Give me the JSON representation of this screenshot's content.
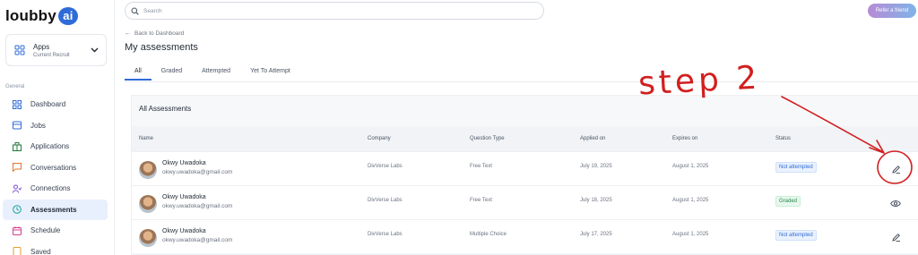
{
  "brand": {
    "logo_text": "loubby",
    "logo_ai": "ai"
  },
  "apps": {
    "title": "Apps",
    "subtitle": "Current Recruit"
  },
  "sidebar": {
    "section_label": "General",
    "items": [
      {
        "label": "Dashboard",
        "icon": "grid-icon"
      },
      {
        "label": "Jobs",
        "icon": "briefcase-icon"
      },
      {
        "label": "Applications",
        "icon": "building-icon"
      },
      {
        "label": "Conversations",
        "icon": "chat-icon"
      },
      {
        "label": "Connections",
        "icon": "people-icon"
      },
      {
        "label": "Assessments",
        "icon": "clock-icon",
        "active": true
      },
      {
        "label": "Schedule",
        "icon": "calendar-icon"
      },
      {
        "label": "Saved",
        "icon": "bookmark-icon"
      }
    ]
  },
  "header": {
    "search_placeholder": "Search",
    "refer_label": "Refer a friend"
  },
  "main": {
    "back_label": "Back to Dashboard",
    "title": "My assessments",
    "tabs": [
      "All",
      "Graded",
      "Attempted",
      "Yet To Attempt"
    ],
    "active_tab": "All",
    "panel_title": "All Assessments",
    "columns": [
      "Name",
      "Company",
      "Question Type",
      "Applied on",
      "Expires on",
      "Status"
    ],
    "rows": [
      {
        "name": "Okwy Uwadoka",
        "email": "okwy.uwadoka@gmail.com",
        "company": "DivVerse Labs",
        "question_type": "Free Text",
        "applied_on": "July 19, 2025",
        "expires_on": "August 1, 2025",
        "status": "Not attempted",
        "action": "edit-icon"
      },
      {
        "name": "Okwy Uwadoka",
        "email": "okwy.uwadoka@gmail.com",
        "company": "DivVerse Labs",
        "question_type": "Free Text",
        "applied_on": "July 18, 2025",
        "expires_on": "August 1, 2025",
        "status": "Graded",
        "action": "eye-icon"
      },
      {
        "name": "Okwy Uwadoka",
        "email": "okwy.uwadoka@gmail.com",
        "company": "DivVerse Labs",
        "question_type": "Multiple Choice",
        "applied_on": "July 17, 2025",
        "expires_on": "August 1, 2025",
        "status": "Not attempted",
        "action": "edit-icon"
      }
    ]
  },
  "annotation": {
    "text": "step 2",
    "color": "#d21f1f"
  },
  "colors": {
    "accent": "#2f6bd8",
    "active_nav_bg": "#e8f0fd",
    "graded": "#23894a"
  }
}
